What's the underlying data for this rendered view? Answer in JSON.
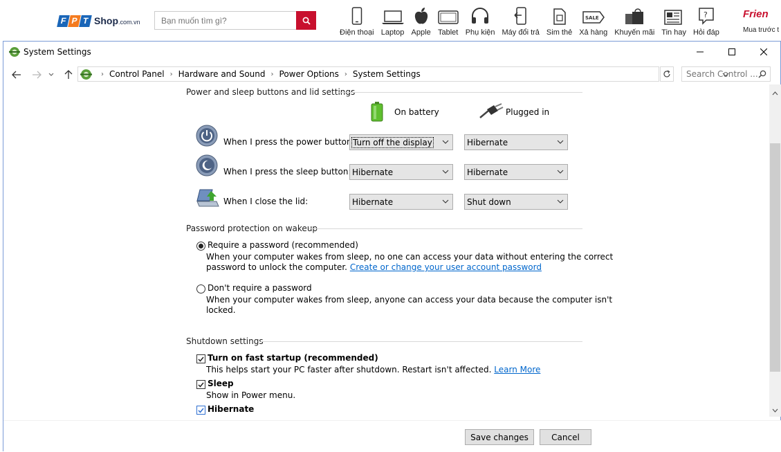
{
  "site": {
    "logo_letters": [
      "F",
      "P",
      "T"
    ],
    "logo_colors": [
      "#1a66b8",
      "#f47b20",
      "#1a66b8"
    ],
    "logo_shop": "Shop",
    "logo_domain": ".com.vn",
    "search_placeholder": "Bạn muốn tìm gì?",
    "categories": [
      {
        "label": "Điện thoại",
        "icon": "phone-icon"
      },
      {
        "label": "Laptop",
        "icon": "laptop-icon"
      },
      {
        "label": "Apple",
        "icon": "apple-icon"
      },
      {
        "label": "Tablet",
        "icon": "tablet-icon"
      },
      {
        "label": "Phụ kiện",
        "icon": "headphones-icon"
      },
      {
        "label": "Máy đổi trả",
        "icon": "exchange-phone-icon"
      },
      {
        "label": "Sim thẻ",
        "icon": "sim-card-icon"
      },
      {
        "label": "Xả hàng",
        "icon": "sale-tag-icon"
      },
      {
        "label": "Khuyến mãi",
        "icon": "shopping-bag-icon"
      },
      {
        "label": "Tin hay",
        "icon": "newspaper-icon"
      },
      {
        "label": "Hỏi đáp",
        "icon": "question-icon"
      }
    ],
    "friend_brand": "Frien",
    "friend_label": "Mua trước t"
  },
  "window": {
    "title": "System Settings",
    "breadcrumbs": [
      "Control Panel",
      "Hardware and Sound",
      "Power Options",
      "System Settings"
    ],
    "search_placeholder": "Search Control ...",
    "accent": "#7a9ad6"
  },
  "power": {
    "section_title": "Power and sleep buttons and lid settings",
    "col_battery": "On battery",
    "col_plugged": "Plugged in",
    "rows": [
      {
        "label": "When I press the power button:",
        "battery": "Turn off the display",
        "plugged": "Hibernate"
      },
      {
        "label": "When I press the sleep button:",
        "battery": "Hibernate",
        "plugged": "Hibernate"
      },
      {
        "label": "When I close the lid:",
        "battery": "Hibernate",
        "plugged": "Shut down"
      }
    ]
  },
  "password": {
    "section_title": "Password protection on wakeup",
    "require_label": "Require a password (recommended)",
    "require_desc_1": "When your computer wakes from sleep, no one can access your data without entering the correct",
    "require_desc_2": "password to unlock the computer.",
    "require_link": "Create or change your user account password",
    "norequire_label": "Don't require a password",
    "norequire_desc_1": "When your computer wakes from sleep, anyone can access your data because the computer isn't",
    "norequire_desc_2": "locked."
  },
  "shutdown": {
    "section_title": "Shutdown settings",
    "fast_label": "Turn on fast startup (recommended)",
    "fast_desc": "This helps start your PC faster after shutdown. Restart isn't affected.",
    "fast_link": "Learn More",
    "sleep_label": "Sleep",
    "sleep_desc": "Show in Power menu.",
    "hibernate_label": "Hibernate"
  },
  "footer": {
    "save_label": "Save changes",
    "cancel_label": "Cancel"
  }
}
